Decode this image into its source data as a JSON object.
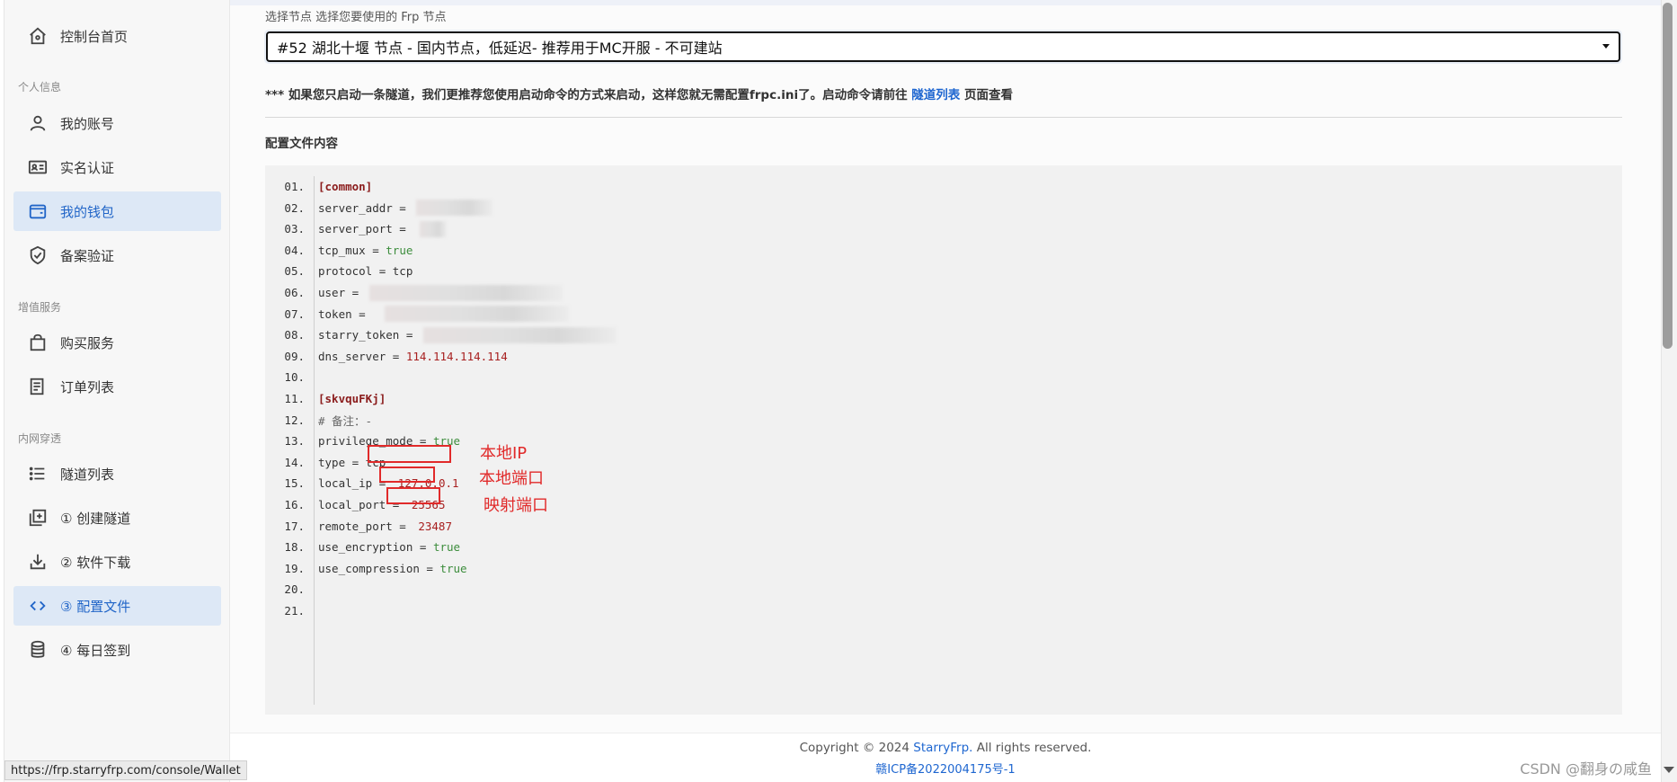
{
  "sidebar": {
    "items": [
      {
        "label": "控制台首页",
        "icon": "home-icon"
      },
      {
        "label": "我的账号",
        "icon": "user-icon"
      },
      {
        "label": "实名认证",
        "icon": "id-card-icon"
      },
      {
        "label": "我的钱包",
        "icon": "wallet-icon",
        "active": true
      },
      {
        "label": "备案验证",
        "icon": "shield-check-icon"
      },
      {
        "label": "购买服务",
        "icon": "shopping-bag-icon"
      },
      {
        "label": "订单列表",
        "icon": "receipt-icon"
      },
      {
        "label": "隧道列表",
        "icon": "list-icon"
      },
      {
        "label": "① 创建隧道",
        "icon": "add-box-icon"
      },
      {
        "label": "② 软件下载",
        "icon": "download-icon"
      },
      {
        "label": "③ 配置文件",
        "icon": "code-icon",
        "active": true
      },
      {
        "label": "④ 每日签到",
        "icon": "database-icon"
      }
    ],
    "sections": {
      "personal": "个人信息",
      "value_added": "增值服务",
      "tunneling": "内网穿透"
    }
  },
  "node_select": {
    "label": "选择节点 选择您要使用的 Frp 节点",
    "value": "#52 湖北十堰 节点 - 国内节点，低延迟- 推荐用于MC开服 - 不可建站"
  },
  "notice": {
    "text": "*** 如果您只启动一条隧道，我们更推荐您使用启动命令的方式来启动，这样您就无需配置frpc.ini了。启动命令请前往",
    "link": "隧道列表",
    "suffix": "页面查看"
  },
  "config": {
    "title": "配置文件内容",
    "lines": [
      {
        "num": "01.",
        "key": "[common]",
        "type": "section"
      },
      {
        "num": "02.",
        "key": "server_addr = ",
        "type": "redacted"
      },
      {
        "num": "03.",
        "key": "server_port = ",
        "type": "redacted"
      },
      {
        "num": "04.",
        "key": "tcp_mux = ",
        "value": "true",
        "type": "bool"
      },
      {
        "num": "05.",
        "key": "protocol = tcp",
        "type": "plain"
      },
      {
        "num": "06.",
        "key": "user = ",
        "type": "redacted"
      },
      {
        "num": "07.",
        "key": "token = ",
        "type": "redacted"
      },
      {
        "num": "08.",
        "key": "starry_token = ",
        "type": "redacted"
      },
      {
        "num": "09.",
        "key": "dns_server = ",
        "value": "114.114.114.114",
        "type": "num"
      },
      {
        "num": "10.",
        "key": "",
        "type": "plain"
      },
      {
        "num": "11.",
        "key": "[skvquFKj]",
        "type": "section"
      },
      {
        "num": "12.",
        "key": "# 备注：-",
        "type": "comment"
      },
      {
        "num": "13.",
        "key": "privilege_mode = ",
        "value": "true",
        "type": "bool"
      },
      {
        "num": "14.",
        "key": "type = tcp",
        "type": "plain"
      },
      {
        "num": "15.",
        "key": "local_ip = ",
        "value": "127.0.0.1",
        "type": "boxed"
      },
      {
        "num": "16.",
        "key": "local_port = ",
        "value": "25565",
        "type": "boxed"
      },
      {
        "num": "17.",
        "key": "remote_port = ",
        "value": "23487",
        "type": "boxed"
      },
      {
        "num": "18.",
        "key": "use_encryption = ",
        "value": "true",
        "type": "bool"
      },
      {
        "num": "19.",
        "key": "use_compression = ",
        "value": "true",
        "type": "bool"
      },
      {
        "num": "20.",
        "key": "",
        "type": "plain"
      },
      {
        "num": "21.",
        "key": "",
        "type": "plain"
      }
    ]
  },
  "annotations": {
    "local_ip": "本地IP",
    "local_port": "本地端口",
    "remote_port": "映射端口"
  },
  "footer": {
    "copyright_prefix": "Copyright © 2024 ",
    "brand": "StarryFrp.",
    "copyright_suffix": " All rights reserved.",
    "icp": "赣ICP备2022004175号-1"
  },
  "status_url": "https://frp.starryfrp.com/console/Wallet",
  "watermark": "CSDN @翻身の咸鱼",
  "colors": {
    "accent": "#1e66d0",
    "active_bg": "#dde8f6",
    "annotation": "#e12a2a",
    "code_bg": "#f1f1f1"
  }
}
